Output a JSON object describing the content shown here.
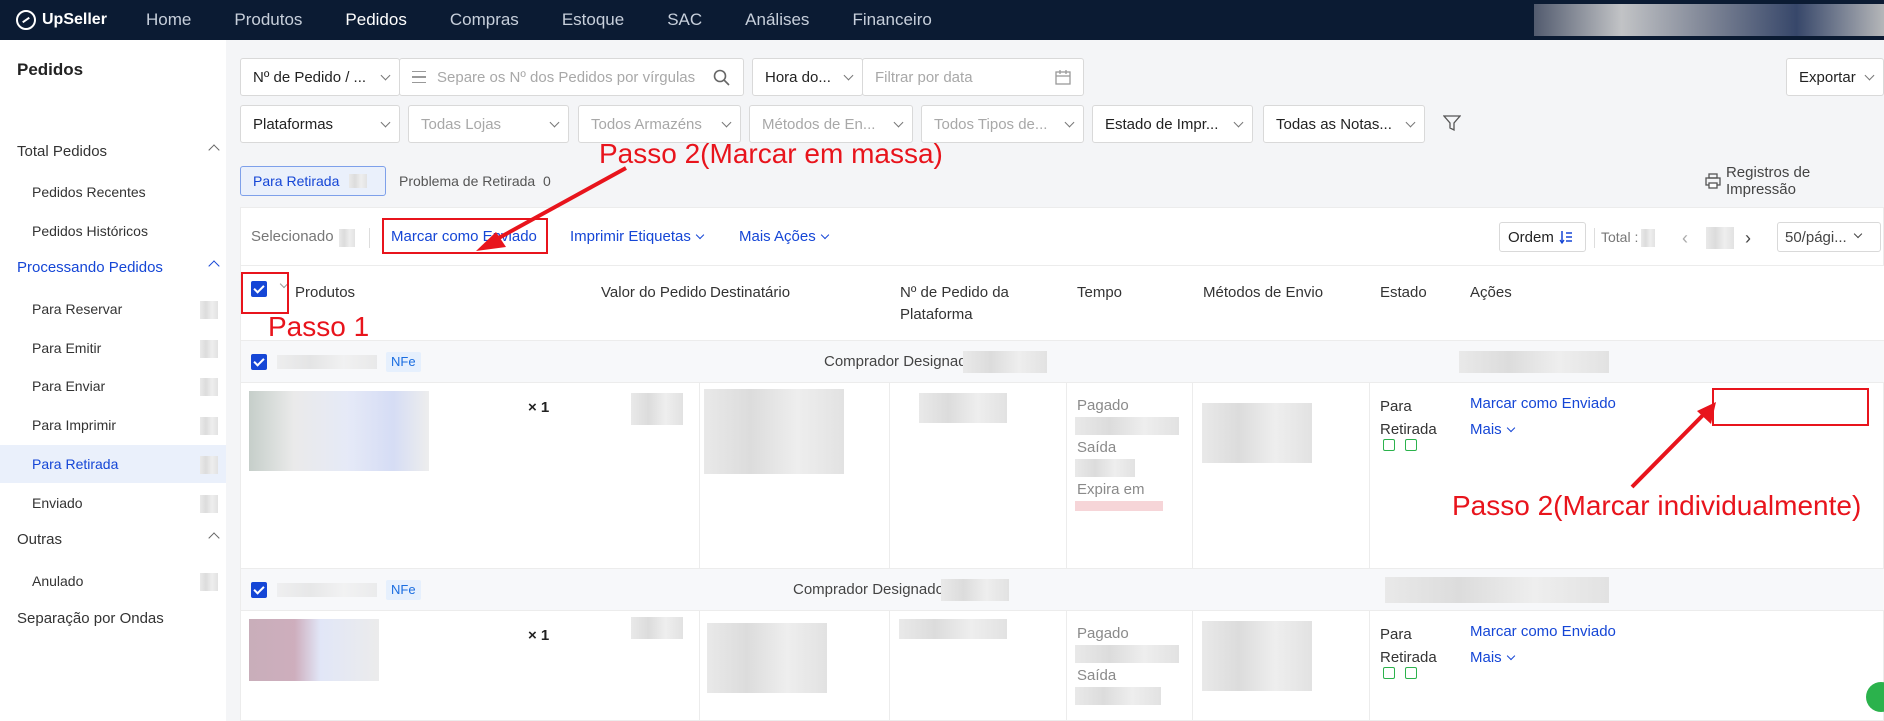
{
  "brand": "UpSeller",
  "nav": {
    "items": [
      "Home",
      "Produtos",
      "Pedidos",
      "Compras",
      "Estoque",
      "SAC",
      "Análises",
      "Financeiro"
    ],
    "active": "Pedidos"
  },
  "sidebar": {
    "title": "Pedidos",
    "groups": [
      {
        "label": "Total Pedidos"
      },
      {
        "label": "Processando Pedidos"
      },
      {
        "label": "Outras"
      }
    ],
    "items": [
      {
        "label": "Pedidos Recentes"
      },
      {
        "label": "Pedidos Históricos"
      },
      {
        "label": "Para Reservar"
      },
      {
        "label": "Para Emitir"
      },
      {
        "label": "Para Enviar"
      },
      {
        "label": "Para Imprimir"
      },
      {
        "label": "Para Retirada"
      },
      {
        "label": "Enviado"
      },
      {
        "label": "Anulado"
      }
    ],
    "bottom": "Separação por Ondas"
  },
  "filters": {
    "order_type": "Nº de Pedido / ...",
    "search_placeholder": "Separe os Nº dos Pedidos por vírgulas",
    "time": "Hora do...",
    "date_placeholder": "Filtrar por data",
    "export": "Exportar",
    "platforms": "Plataformas",
    "stores": "Todas Lojas",
    "warehouses": "Todos Armazéns",
    "ship_methods": "Métodos de En...",
    "types": "Todos Tipos de...",
    "print_state": "Estado de Impr...",
    "notes": "Todas as Notas..."
  },
  "tabs": {
    "active": "Para Retirada",
    "problem": "Problema de Retirada",
    "problem_count": "0",
    "print_log": "Registros de Impressão"
  },
  "toolbar": {
    "selected": "Selecionado",
    "mark_shipped": "Marcar como Enviado",
    "print_labels": "Imprimir Etiquetas",
    "more_actions": "Mais Ações",
    "order": "Ordem",
    "total": "Total :",
    "page_size": "50/pági..."
  },
  "table": {
    "headers": [
      "Produtos",
      "Valor do Pedido",
      "Destinatário",
      "Nº de Pedido da Plataforma",
      "Tempo",
      "Métodos de Envio",
      "Estado",
      "Ações"
    ],
    "groups": [
      {
        "badge": "NFe",
        "buyer_label": "Comprador Designado:",
        "qty": "× 1",
        "times": [
          "Pagado",
          "Saída",
          "Expira em"
        ],
        "status": "Para Retirada",
        "action": "Marcar como Enviado",
        "more": "Mais"
      },
      {
        "badge": "NFe",
        "buyer_label": "Comprador Designado:",
        "qty": "× 1",
        "times": [
          "Pagado",
          "Saída"
        ],
        "status": "Para Retirada",
        "action": "Marcar como Enviado",
        "more": "Mais"
      }
    ]
  },
  "annotations": {
    "step1": "Passo 1",
    "step2_bulk": "Passo 2(Marcar em massa)",
    "step2_individual": "Passo 2(Marcar individualmente)"
  },
  "colors": {
    "topbar": "#0b1b33",
    "accent": "#1546d6",
    "annotation": "#e8141c"
  }
}
